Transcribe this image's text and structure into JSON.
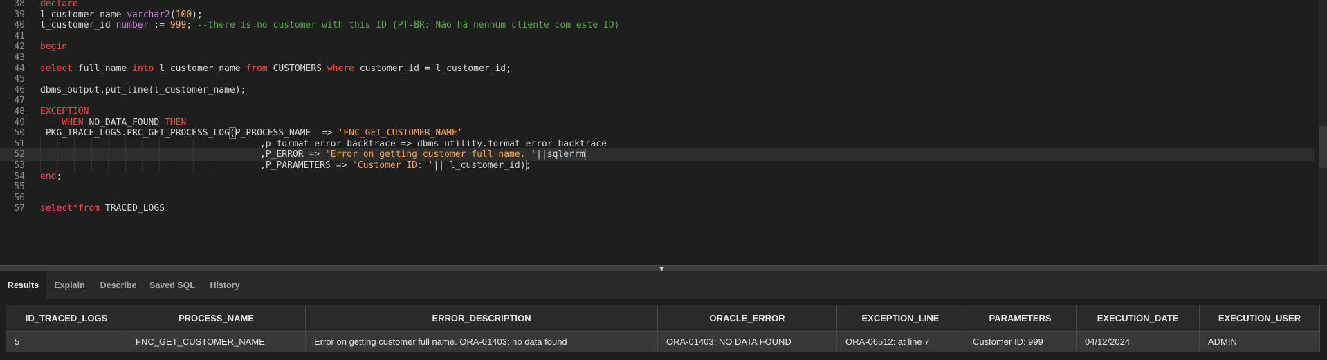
{
  "editor": {
    "lines": [
      {
        "n": "38",
        "t": "",
        "guides": 0
      },
      {
        "n": "39",
        "t": "",
        "guides": 0
      },
      {
        "n": "40",
        "t": "",
        "guides": 0
      },
      {
        "n": "41",
        "t": "",
        "guides": 0
      },
      {
        "n": "42",
        "t": "",
        "guides": 0
      },
      {
        "n": "43",
        "t": "",
        "guides": 0
      },
      {
        "n": "44",
        "t": "",
        "guides": 0
      },
      {
        "n": "45",
        "t": "",
        "guides": 0
      },
      {
        "n": "46",
        "t": "",
        "guides": 0
      },
      {
        "n": "47",
        "t": "",
        "guides": 0
      },
      {
        "n": "48",
        "t": "",
        "guides": 0
      },
      {
        "n": "49",
        "t": "",
        "guides": 0
      },
      {
        "n": "50",
        "t": "",
        "guides": 0
      },
      {
        "n": "51",
        "t": "",
        "guides": 11
      },
      {
        "n": "52",
        "t": "",
        "guides": 11
      },
      {
        "n": "53",
        "t": "",
        "guides": 11
      },
      {
        "n": "54",
        "t": "",
        "guides": 0
      },
      {
        "n": "55",
        "t": "",
        "guides": 0
      },
      {
        "n": "56",
        "t": "",
        "guides": 0
      },
      {
        "n": "57",
        "t": "",
        "guides": 0
      }
    ],
    "code": {
      "l38": [
        "declare"
      ],
      "l39": [
        "l_customer_name ",
        "varchar2",
        "(",
        "100",
        ");"
      ],
      "l40": [
        "l_customer_id ",
        "number",
        " := ",
        "999",
        "; ",
        "--there is no customer with this ID (PT-BR: Não há nenhum cliente com este ID)"
      ],
      "l42": [
        "begin"
      ],
      "l44": [
        "select",
        " full_name ",
        "into",
        " l_customer_name ",
        "from",
        " CUSTOMERS ",
        "where",
        " customer_id = l_customer_id;"
      ],
      "l46": [
        "dbms_output.put_line(l_customer_name);"
      ],
      "l48": [
        "EXCEPTION"
      ],
      "l49": [
        "    ",
        "WHEN",
        " NO_DATA_FOUND ",
        "THEN"
      ],
      "l50": [
        " PKG_TRACE_LOGS.PRC_GET_PROCESS_LOG",
        "(",
        "P_PROCESS_NAME  => ",
        "'FNC_GET_CUSTOMER_NAME'"
      ],
      "l51": [
        ",p_format_error_backtrace => dbms_utility.format_error_backtrace"
      ],
      "l52": [
        ",P_ERROR => ",
        "'Error on getting customer full name. '",
        "||",
        "sqlerrm"
      ],
      "l53": [
        ",P_PARAMETERS => ",
        "'Customer ID: '",
        "|| l_customer_id",
        ")",
        ";"
      ],
      "l54": [
        "end",
        ";"
      ],
      "l57": [
        "select",
        "*",
        "from",
        " TRACED_LOGS"
      ]
    }
  },
  "tabs": [
    {
      "label": "Results",
      "active": true
    },
    {
      "label": "Explain",
      "active": false
    },
    {
      "label": "Describe",
      "active": false
    },
    {
      "label": "Saved SQL",
      "active": false
    },
    {
      "label": "History",
      "active": false
    }
  ],
  "results": {
    "columns": [
      "ID_TRACED_LOGS",
      "PROCESS_NAME",
      "ERROR_DESCRIPTION",
      "ORACLE_ERROR",
      "EXCEPTION_LINE",
      "PARAMETERS",
      "EXECUTION_DATE",
      "EXECUTION_USER"
    ],
    "rows": [
      [
        "5",
        "FNC_GET_CUSTOMER_NAME",
        "Error on getting customer full name. ORA-01403: no data found",
        "ORA-01403: NO DATA FOUND",
        "ORA-06512: at line 7",
        "Customer ID: 999",
        "04/12/2024",
        "ADMIN"
      ]
    ]
  },
  "colors": {
    "keyword": "#ff4444",
    "type": "#c37bd8",
    "number": "#ffa94d",
    "string": "#f7a24b",
    "comment": "#57a64a",
    "editor_bg": "#1e1e1e"
  },
  "icons": {
    "splitter": "triangle-down-icon"
  }
}
